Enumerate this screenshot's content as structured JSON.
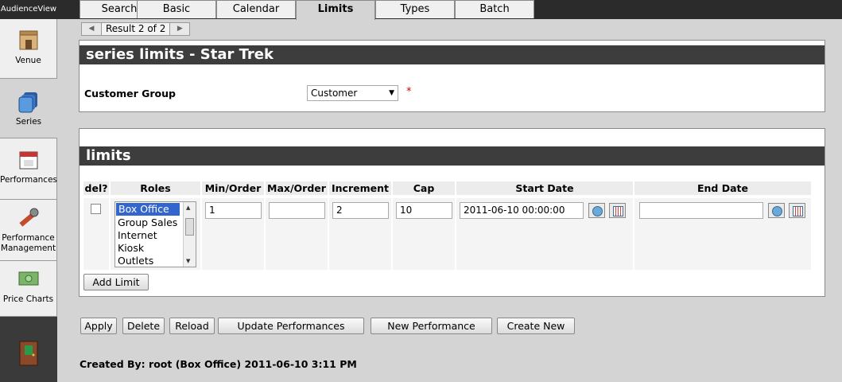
{
  "sidebar": {
    "brand": "AudienceView",
    "items": [
      {
        "label": "Venue"
      },
      {
        "label": "Series"
      },
      {
        "label": "Performances"
      },
      {
        "label": "Performance",
        "label2": "Management"
      },
      {
        "label": "Price Charts"
      }
    ]
  },
  "tabs": [
    "Search",
    "Basic",
    "Calendar",
    "Limits",
    "Types",
    "Batch"
  ],
  "active_tab": "Limits",
  "pager": {
    "text": "Result 2 of 2"
  },
  "series_panel": {
    "title": "series limits - Star Trek",
    "customer_group_label": "Customer Group",
    "customer_group_value": "Customer",
    "required_mark": "*"
  },
  "limits_panel": {
    "title": "limits",
    "columns": [
      "del?",
      "Roles",
      "Min/Order",
      "Max/Order",
      "Increment",
      "Cap",
      "Start Date",
      "End Date"
    ],
    "row": {
      "roles": [
        "Box Office",
        "Group Sales",
        "Internet",
        "Kiosk",
        "Outlets"
      ],
      "selected_role": "Box Office",
      "min_order": "1",
      "max_order": "",
      "increment": "2",
      "cap": "10",
      "start_date": "2011-06-10 00:00:00",
      "end_date": ""
    },
    "add_button": "Add Limit"
  },
  "actions": {
    "apply": "Apply",
    "delete": "Delete",
    "reload": "Reload",
    "update_performances": "Update Performances",
    "new_performance": "New Performance",
    "create_new": "Create New"
  },
  "footer": {
    "created_by": "Created By: root (Box Office) 2011-06-10 3:11 PM"
  }
}
